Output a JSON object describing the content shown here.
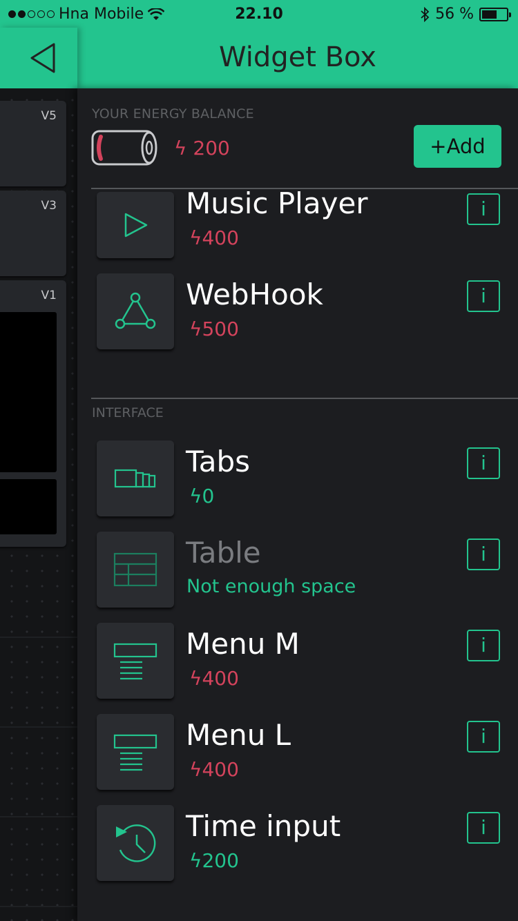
{
  "status_bar": {
    "carrier": "Hna Mobile",
    "time": "22.10",
    "battery_percent": "56 %"
  },
  "header": {
    "title": "Widget Box"
  },
  "left_pane": {
    "pins": [
      "V5",
      "V3",
      "V1"
    ]
  },
  "energy": {
    "label": "YOUR ENERGY BALANCE",
    "value": "200",
    "add_label": "+Add"
  },
  "sections": {
    "interface_label": "INTERFACE"
  },
  "widgets_top": [
    {
      "name": "Music Player",
      "price": "400",
      "icon": "play-icon"
    },
    {
      "name": "WebHook",
      "price": "500",
      "icon": "webhook-icon"
    }
  ],
  "widgets_interface": [
    {
      "name": "Tabs",
      "price": "0",
      "icon": "tabs-icon"
    },
    {
      "name": "Table",
      "price": "Not enough space",
      "icon": "table-icon"
    },
    {
      "name": "Menu M",
      "price": "400",
      "icon": "menu-icon"
    },
    {
      "name": "Menu L",
      "price": "400",
      "icon": "menu-icon"
    },
    {
      "name": "Time input",
      "price": "200",
      "icon": "time-input-icon"
    }
  ],
  "info_label": "i",
  "bolt": "ϟ",
  "colors": {
    "accent": "#23c48e",
    "energy": "#d3435c",
    "background": "#1c1d20"
  }
}
